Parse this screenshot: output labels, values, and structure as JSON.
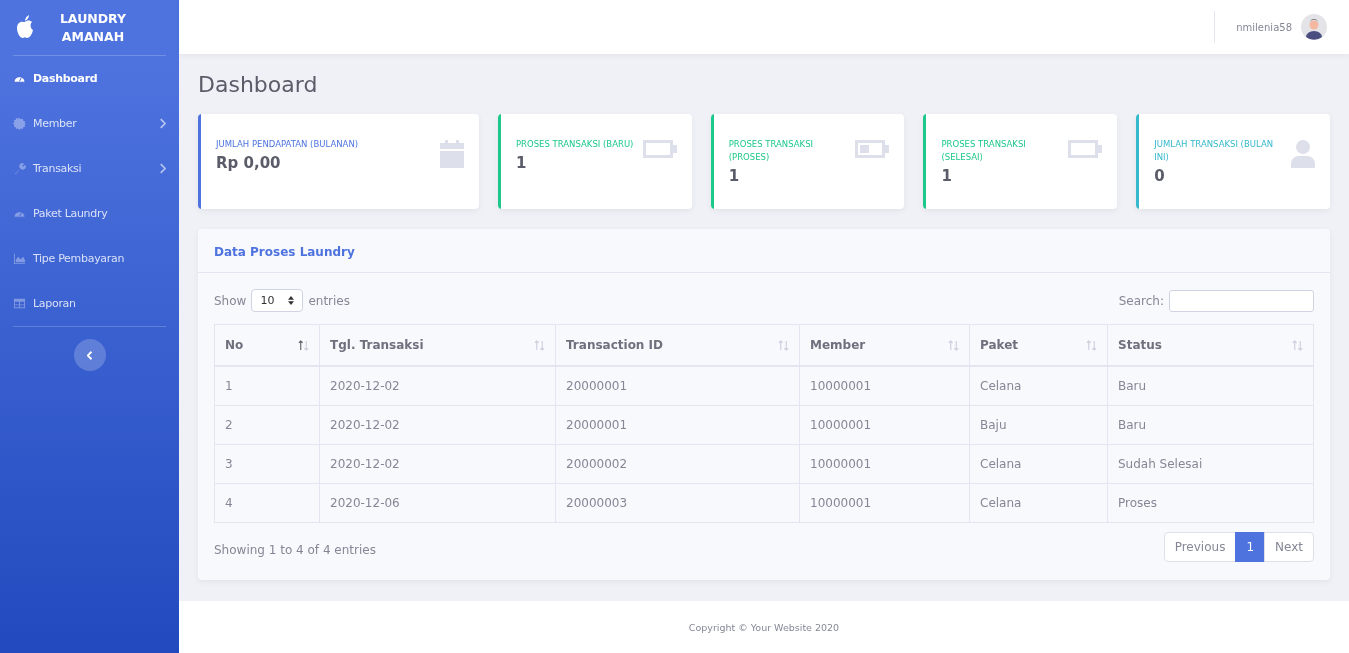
{
  "sidebar": {
    "brand": "LAUNDRY AMANAH",
    "items": [
      {
        "label": "Dashboard",
        "kind": "gauge",
        "selected": true,
        "submenu": false
      },
      {
        "label": "Member",
        "kind": "gear",
        "selected": false,
        "submenu": true
      },
      {
        "label": "Transaksi",
        "kind": "wrench",
        "selected": false,
        "submenu": true
      },
      {
        "label": "Paket Laundry",
        "kind": "gauge",
        "selected": false,
        "submenu": false
      },
      {
        "label": "Tipe Pembayaran",
        "kind": "chart",
        "selected": false,
        "submenu": false
      },
      {
        "label": "Laporan",
        "kind": "table",
        "selected": false,
        "submenu": false
      }
    ]
  },
  "topbar": {
    "username": "nmilenia58"
  },
  "page_title": "Dashboard",
  "cards": [
    {
      "label": "JUMLAH PENDAPATAN (BULANAN)",
      "value": "Rp 0,00",
      "color": "#4e73df",
      "kind": "calendar"
    },
    {
      "label": "PROSES TRANSAKSI (BARU)",
      "value": "1",
      "color": "#1cc88a",
      "kind": "battery"
    },
    {
      "label": "PROSES TRANSAKSI (PROSES)",
      "value": "1",
      "color": "#1cc88a",
      "kind": "batterylow"
    },
    {
      "label": "PROSES TRANSAKSI (SELESAI)",
      "value": "1",
      "color": "#1cc88a",
      "kind": "battery"
    },
    {
      "label": "JUMLAH TRANSAKSI (BULAN INI)",
      "value": "0",
      "color": "#36b9cc",
      "kind": "user"
    }
  ],
  "table_panel": {
    "title": "Data Proses Laundry",
    "show_label": "Show",
    "page_size": "10",
    "entries_label": "entries",
    "search_label": "Search:",
    "columns": [
      {
        "label": "No",
        "sorted": true
      },
      {
        "label": "Tgl. Transaksi",
        "sorted": false
      },
      {
        "label": "Transaction ID",
        "sorted": false
      },
      {
        "label": "Member",
        "sorted": false
      },
      {
        "label": "Paket",
        "sorted": false
      },
      {
        "label": "Status",
        "sorted": false
      }
    ],
    "rows": [
      [
        "1",
        "2020-12-02",
        "20000001",
        "10000001",
        "Celana",
        "Baru"
      ],
      [
        "2",
        "2020-12-02",
        "20000001",
        "10000001",
        "Baju",
        "Baru"
      ],
      [
        "3",
        "2020-12-02",
        "20000002",
        "10000001",
        "Celana",
        "Sudah Selesai"
      ],
      [
        "4",
        "2020-12-06",
        "20000003",
        "10000001",
        "Celana",
        "Proses"
      ]
    ],
    "info": "Showing 1 to 4 of 4 entries",
    "previous": "Previous",
    "next": "Next",
    "pages": [
      {
        "label": "1",
        "selected": true
      }
    ]
  },
  "footer": "Copyright © Your Website 2020"
}
